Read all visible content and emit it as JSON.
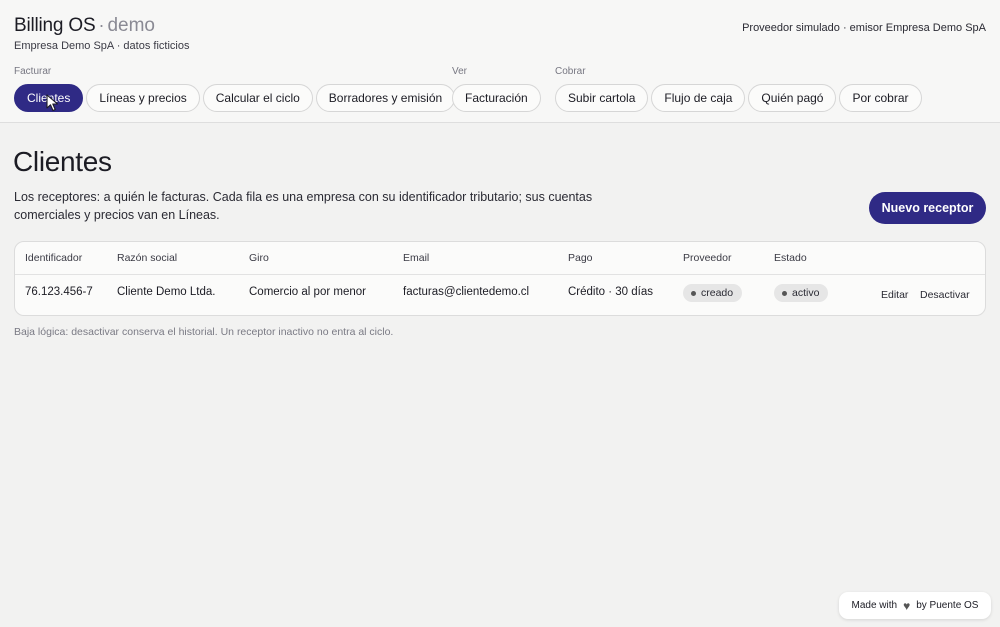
{
  "header": {
    "title": "Billing OS",
    "separator": "·",
    "env": "demo",
    "subtitle": "Empresa Demo SpA · datos ficticios",
    "provider": "Proveedor simulado · emisor Empresa Demo SpA"
  },
  "nav": {
    "groups": [
      {
        "label": "Facturar",
        "items": [
          "Clientes",
          "Líneas y precios",
          "Calcular el ciclo",
          "Borradores y emisión"
        ]
      },
      {
        "label": "Ver",
        "items": [
          "Facturación"
        ]
      },
      {
        "label": "Cobrar",
        "items": [
          "Subir cartola",
          "Flujo de caja",
          "Quién pagó",
          "Por cobrar"
        ]
      }
    ],
    "active": "Clientes"
  },
  "page": {
    "title": "Clientes",
    "description": "Los receptores: a quién le facturas. Cada fila es una empresa con su identificador tributario; sus cuentas comerciales y precios van en Líneas.",
    "primary_button": "Nuevo receptor"
  },
  "table": {
    "columns": [
      "Identificador",
      "Razón social",
      "Giro",
      "Email",
      "Pago",
      "Proveedor",
      "Estado"
    ],
    "rows": [
      {
        "identificador": "76.123.456-7",
        "razon_social": "Cliente Demo Ltda.",
        "giro": "Comercio al por menor",
        "email": "facturas@clientedemo.cl",
        "pago": "Crédito · 30 días",
        "proveedor": "creado",
        "estado": "activo",
        "actions": [
          "Editar",
          "Desactivar"
        ]
      }
    ]
  },
  "footnote": "Baja lógica: desactivar conserva el historial. Un receptor inactivo no entra al ciclo.",
  "badge": {
    "made_with": "Made with",
    "by": "by Puente OS",
    "icon": "heart-icon"
  },
  "colors": {
    "accent": "#2f2a85",
    "background": "#f2f2f1",
    "header_bg": "#f7f7f6"
  }
}
